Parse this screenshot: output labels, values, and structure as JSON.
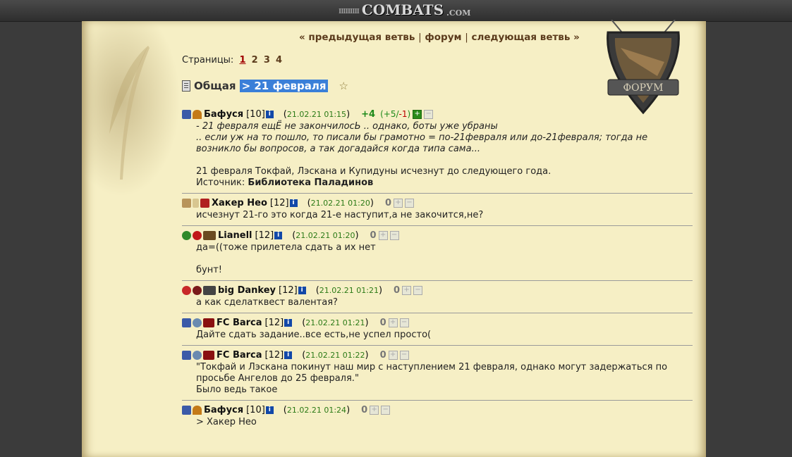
{
  "header": {
    "logo_bars": "IIIIIIIII",
    "logo_name": "COMBATS",
    "logo_domain": ".COM"
  },
  "nav": {
    "prev": "« предыдущая ветвь",
    "forum": "форум",
    "next": "следующая ветвь »",
    "sep": "|"
  },
  "pages": {
    "label": "Страницы:",
    "items": [
      "1",
      "2",
      "3",
      "4"
    ],
    "current": "1"
  },
  "badge": {
    "text": "ФОРУМ"
  },
  "thread": {
    "category": "Общая",
    "title": "> 21 февраля",
    "star": "☆"
  },
  "posts": [
    {
      "nick": "Бафуся",
      "level": "[10]",
      "time": "21.02.21 01:15",
      "score": "+4",
      "plus": "+5",
      "minus": "-1",
      "lines": [
        "- 21 февраля ещЁ не закончилосЬ .. однако, боты уже убраны",
        ".. если уж на то пошло, то писали бы грамотно = по-21февраля или до-21февраля; тогда не",
        "возникло бы вопросов, а так догадайся когда типа сама..."
      ],
      "extra": "21 февраля Токфай, Лэскана и Купидуны исчезнут до следующего года.",
      "source_label": "Источник:",
      "source": "Библиотека Паладинов"
    },
    {
      "nick": "Хакер Нео",
      "level": "[12]",
      "time": "21.02.21 01:20",
      "score": "0",
      "lines": [
        "исчезнут 21-го это когда 21-е наступит,а не закочится,не?"
      ]
    },
    {
      "nick": "Lianell",
      "level": "[12]",
      "time": "21.02.21 01:20",
      "score": "0",
      "lines": [
        "да=((тоже прилетела сдать а их нет"
      ],
      "extra": "бунт!"
    },
    {
      "nick": "big Dankey",
      "level": "[12]",
      "time": "21.02.21 01:21",
      "score": "0",
      "lines": [
        "а как сделатквест валентая?"
      ]
    },
    {
      "nick": "FC Barca",
      "level": "[12]",
      "time": "21.02.21 01:21",
      "score": "0",
      "lines": [
        "Дайте сдать задание..все есть,не успел просто("
      ]
    },
    {
      "nick": "FC Barca",
      "level": "[12]",
      "time": "21.02.21 01:22",
      "score": "0",
      "lines": [
        "\"Токфай и Лэскана покинут наш мир с наступлением 21 февраля, однако могут задержаться по",
        "просьбе Ангелов до 25 февраля.\"",
        "Было ведь такое"
      ]
    },
    {
      "nick": "Бафуся",
      "level": "[10]",
      "time": "21.02.21 01:24",
      "score": "0",
      "lines": [
        "> Хакер Нео"
      ]
    }
  ],
  "colors": {
    "parchment": "#f6efc5",
    "nav_text": "#5b3b1c",
    "time": "#2b7a16",
    "selection": "#3a7fd8"
  }
}
